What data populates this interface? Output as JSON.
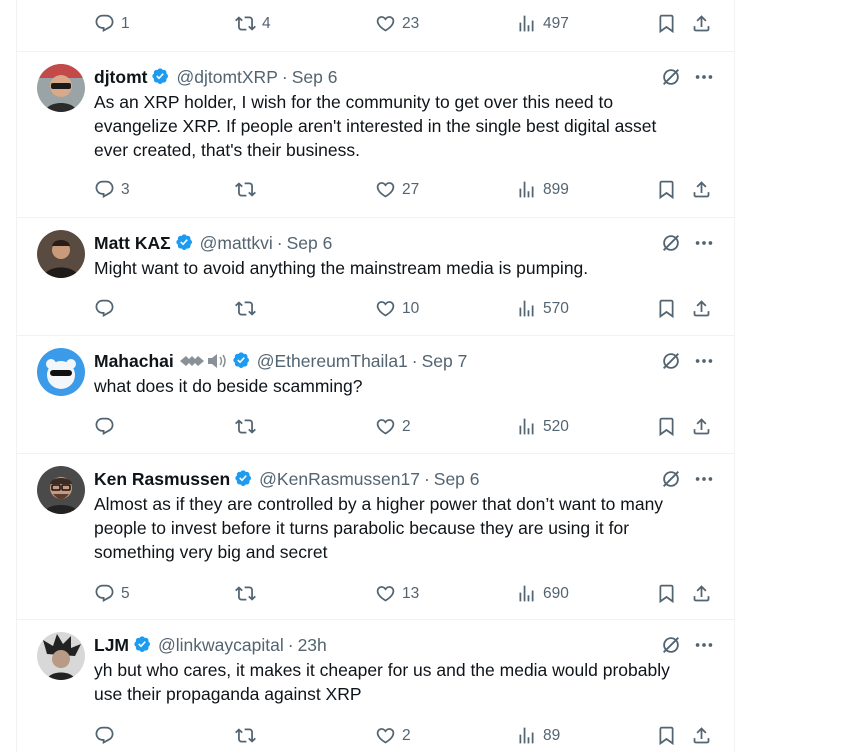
{
  "top_actions": {
    "replies": "1",
    "retweets": "4",
    "likes": "23",
    "views": "497"
  },
  "posts": [
    {
      "name": "djtomt",
      "handle": "@djtomtXRP",
      "date": "Sep 6",
      "text": [
        "As an XRP holder, I wish for the community to get over this need to",
        "evangelize XRP. If people aren't interested in the single best digital asset",
        "ever created, that's their business."
      ],
      "replies": "3",
      "retweets": "",
      "likes": "27",
      "views": "899"
    },
    {
      "name": "Matt ΚΑΣ",
      "handle": "@mattkvi",
      "date": "Sep 6",
      "text": [
        "Might want to avoid anything the mainstream media is pumping."
      ],
      "replies": "",
      "retweets": "",
      "likes": "10",
      "views": "570"
    },
    {
      "name": "Mahachai",
      "handle": "@EthereumThaila1",
      "date": "Sep 7",
      "text": [
        "what does it do beside scamming?"
      ],
      "replies": "",
      "retweets": "",
      "likes": "2",
      "views": "520"
    },
    {
      "name": "Ken Rasmussen",
      "handle": "@KenRasmussen17",
      "date": "Sep 6",
      "text": [
        "Almost as if they are controlled by a higher power that don’t want to many",
        "people to invest before it turns parabolic because they are using it for",
        "something very big and secret"
      ],
      "replies": "5",
      "retweets": "",
      "likes": "13",
      "views": "690"
    },
    {
      "name": "LJM",
      "handle": "@linkwaycapital",
      "date": "23h",
      "text": [
        "yh but who cares, it makes it cheaper for us and the media would probably",
        "use their propaganda against XRP"
      ],
      "replies": "",
      "retweets": "",
      "likes": "2",
      "views": "89"
    }
  ],
  "colors": {
    "text": "#0f1419",
    "secondary": "#536471",
    "verified": "#1d9bf0",
    "divider": "#eff3f4"
  },
  "icons": [
    "reply-icon",
    "retweet-icon",
    "like-icon",
    "views-icon",
    "bookmark-icon",
    "share-icon",
    "grok-icon",
    "more-icon",
    "verified-badge-icon"
  ]
}
